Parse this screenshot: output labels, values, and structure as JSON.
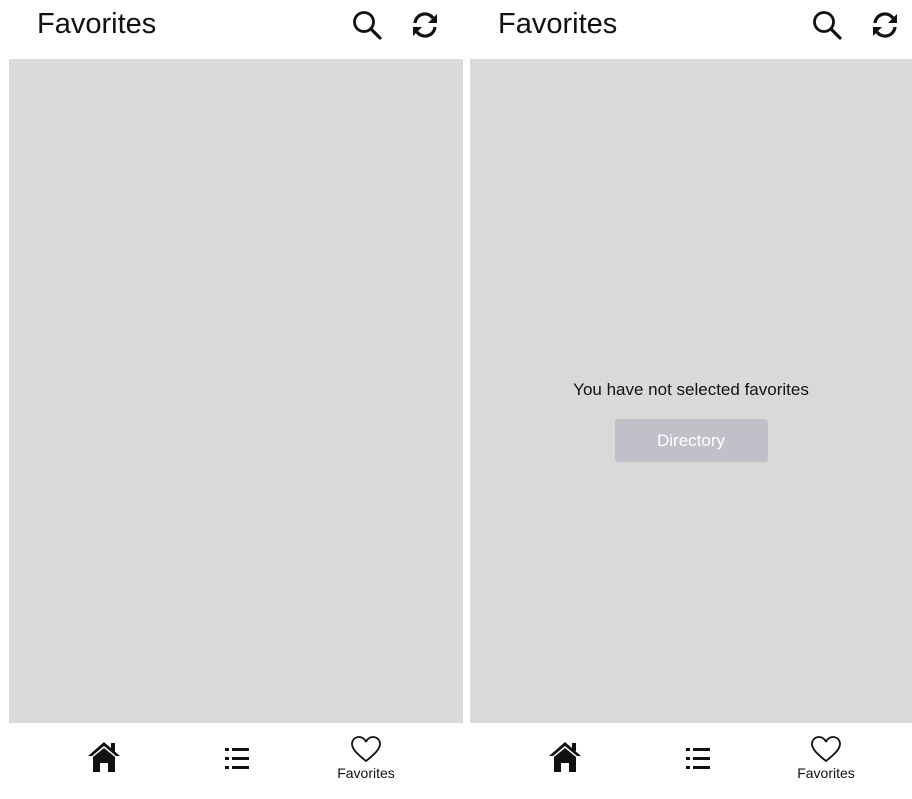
{
  "screens": [
    {
      "header": {
        "title": "Favorites",
        "icons": [
          "search-icon",
          "refresh-icon"
        ]
      },
      "content": {
        "state": "blank"
      },
      "nav": {
        "items": [
          {
            "id": "home",
            "icon": "home-icon",
            "label": ""
          },
          {
            "id": "directory",
            "icon": "list-icon",
            "label": ""
          },
          {
            "id": "favorites",
            "icon": "heart-icon",
            "label": "Favorites"
          }
        ]
      }
    },
    {
      "header": {
        "title": "Favorites",
        "icons": [
          "search-icon",
          "refresh-icon"
        ]
      },
      "content": {
        "state": "empty",
        "message": "You have not selected favorites",
        "button_label": "Directory"
      },
      "nav": {
        "items": [
          {
            "id": "home",
            "icon": "home-icon",
            "label": ""
          },
          {
            "id": "directory",
            "icon": "list-icon",
            "label": ""
          },
          {
            "id": "favorites",
            "icon": "heart-icon",
            "label": "Favorites"
          }
        ]
      }
    }
  ],
  "colors": {
    "content_background": "#d9d9d9",
    "button_background": "#c0c0c8",
    "button_text": "#ffffff",
    "text": "#111111"
  }
}
